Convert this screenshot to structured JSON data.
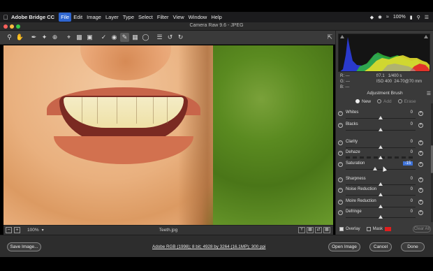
{
  "menubar": {
    "app": "Adobe Bridge CC",
    "items": [
      "File",
      "Edit",
      "Image",
      "Layer",
      "Type",
      "Select",
      "Filter",
      "View",
      "Window",
      "Help"
    ],
    "active": "File",
    "battery": "100%"
  },
  "window": {
    "title": "Camera Raw 9.6  -  JPEG"
  },
  "toolbar": {
    "tools": [
      "zoom-icon",
      "hand-icon",
      "white-balance-icon",
      "color-sampler-icon",
      "targeted-adjustment-icon",
      "crop-icon",
      "straighten-icon",
      "spot-removal-icon",
      "red-eye-icon",
      "adjustment-brush-icon",
      "graduated-filter-icon",
      "radial-filter-icon",
      "preferences-icon",
      "rotate-ccw-icon",
      "rotate-cw-icon"
    ],
    "selected": "adjustment-brush-icon"
  },
  "readout": {
    "r": "R:",
    "g": "G:",
    "b": "B:",
    "dash": "---",
    "aperture": "f/7.1",
    "shutter": "1/400 s",
    "iso": "ISO 400",
    "lens": "24-70@70 mm"
  },
  "panel": {
    "title": "Adjustment Brush",
    "modes": [
      "New",
      "Add",
      "Erase"
    ],
    "sliders": [
      {
        "label": "Whites",
        "value": "0",
        "pos": 0.5
      },
      {
        "label": "Blacks",
        "value": "0",
        "pos": 0.5
      },
      {
        "label": "Clarity",
        "value": "0",
        "pos": 0.5
      },
      {
        "label": "Dehaze",
        "value": "0",
        "pos": 0.5
      },
      {
        "label": "Saturation",
        "value": "-15",
        "pos": 0.42,
        "highlight": true
      },
      {
        "label": "Sharpness",
        "value": "0",
        "pos": 0.5
      },
      {
        "label": "Noise Reduction",
        "value": "0",
        "pos": 0.5
      },
      {
        "label": "Moire Reduction",
        "value": "0",
        "pos": 0.5
      },
      {
        "label": "Defringe",
        "value": "0",
        "pos": 0.5
      }
    ],
    "overlay": "Overlay",
    "mask": "Mask",
    "clear_all": "Clear All"
  },
  "status": {
    "zoom": "100%",
    "filename": "Teeth.jpg"
  },
  "bottom": {
    "save": "Save Image...",
    "workflow": "Adobe RGB (1998); 8 bit; 4928 by 3264 (16.1MP); 300 ppi",
    "open": "Open Image",
    "cancel": "Cancel",
    "done": "Done"
  }
}
